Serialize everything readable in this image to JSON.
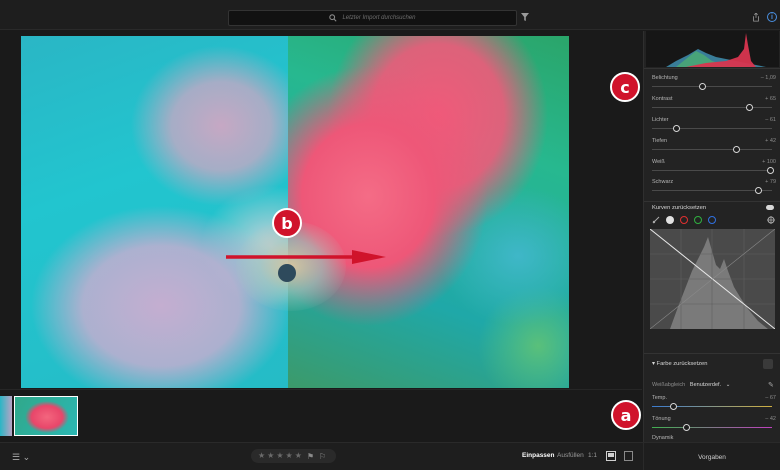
{
  "topbar": {
    "search_placeholder": "Letzter Import durchsuchen",
    "icons": [
      "search-icon",
      "filter-icon",
      "share-icon",
      "info-icon"
    ]
  },
  "annotations": {
    "a": "a",
    "b": "b",
    "c": "c"
  },
  "panel": {
    "sliders": [
      {
        "name": "Belichtung",
        "value": "– 1,09",
        "level": 0.42
      },
      {
        "name": "Kontrast",
        "value": "+ 65",
        "level": 0.825
      },
      {
        "name": "Lichter",
        "value": "– 61",
        "level": 0.2
      },
      {
        "name": "Tiefen",
        "value": "+ 42",
        "level": 0.71
      },
      {
        "name": "Weiß",
        "value": "+ 100",
        "level": 1.0
      },
      {
        "name": "Schwarz",
        "value": "+ 79",
        "level": 0.895
      }
    ],
    "curve_title": "Kurven zurücksetzen",
    "color_title": "Farbe zurücksetzen",
    "wb_label": "Weißabgleich",
    "wb_value": "Benutzerdef.",
    "color_sliders": [
      {
        "name": "Temp.",
        "value": "– 67",
        "level": 0.18
      },
      {
        "name": "Tönung",
        "value": "– 42",
        "level": 0.29
      }
    ],
    "dynamics_label": "Dynamik"
  },
  "bottombar": {
    "fit": "Einpassen",
    "fill": "Ausfüllen",
    "ratio": "1:1",
    "presets": "Vorgaben",
    "stars_count": 5
  },
  "colors": {
    "badge": "#d0132b",
    "accent_blue": "#4a90e2"
  }
}
